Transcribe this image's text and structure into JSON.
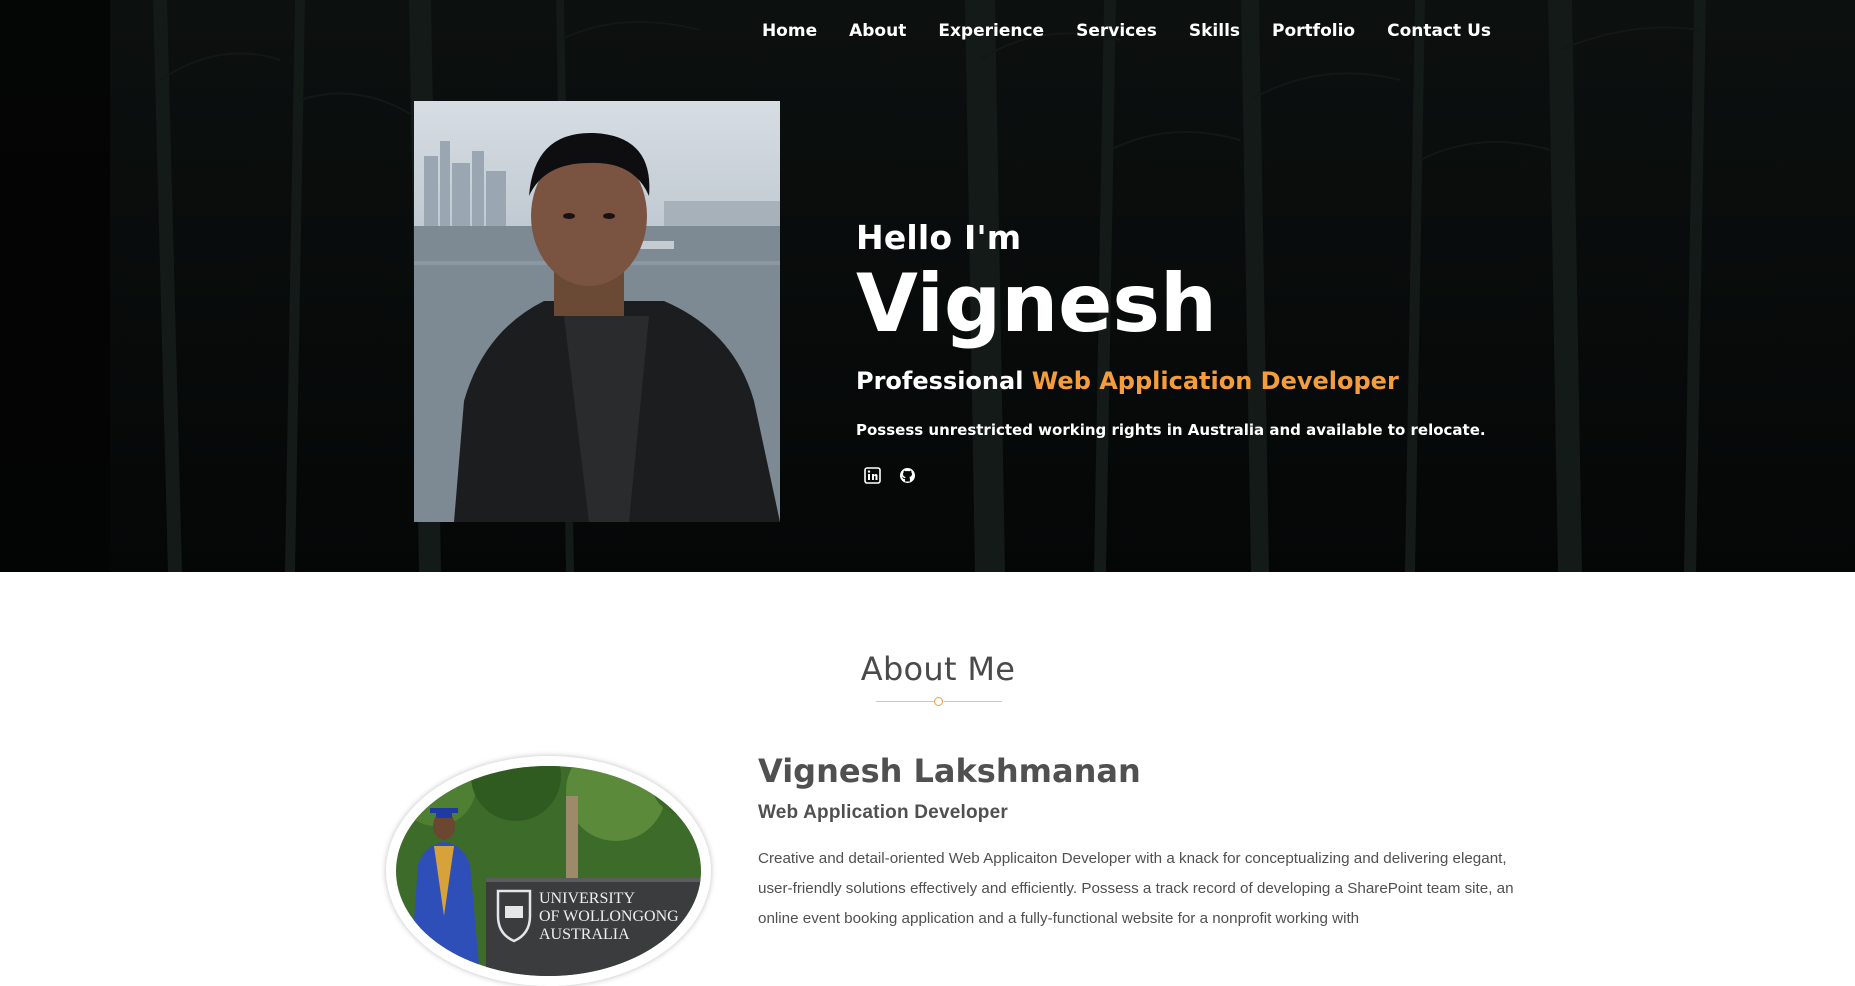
{
  "nav": {
    "items": [
      "Home",
      "About",
      "Experience",
      "Services",
      "Skills",
      "Portfolio",
      "Contact Us"
    ]
  },
  "hero": {
    "greeting": "Hello I'm",
    "name": "Vignesh",
    "tagline_prefix": "Professional",
    "tagline_accent": "Web Application Developer",
    "rights": "Possess unrestricted working rights in Australia and available to relocate.",
    "social": [
      {
        "icon": "linkedin-icon"
      },
      {
        "icon": "github-icon"
      }
    ]
  },
  "about": {
    "title": "About Me",
    "sign_text": [
      "UNIVERSITY",
      "OF WOLLONGONG",
      "AUSTRALIA"
    ],
    "full_name": "Vignesh Lakshmanan",
    "role": "Web Application Developer",
    "bio": "Creative and detail-oriented Web Applicaiton Developer with a knack for conceptualizing and delivering elegant, user-friendly solutions effectively and efficiently. Possess a track record of developing a SharePoint team site, an online event booking application and a fully-functional website for a nonprofit working with"
  },
  "colors": {
    "accent": "#f59d3c",
    "hero_bg": "#070909",
    "text_dark": "#4a4a4a"
  }
}
